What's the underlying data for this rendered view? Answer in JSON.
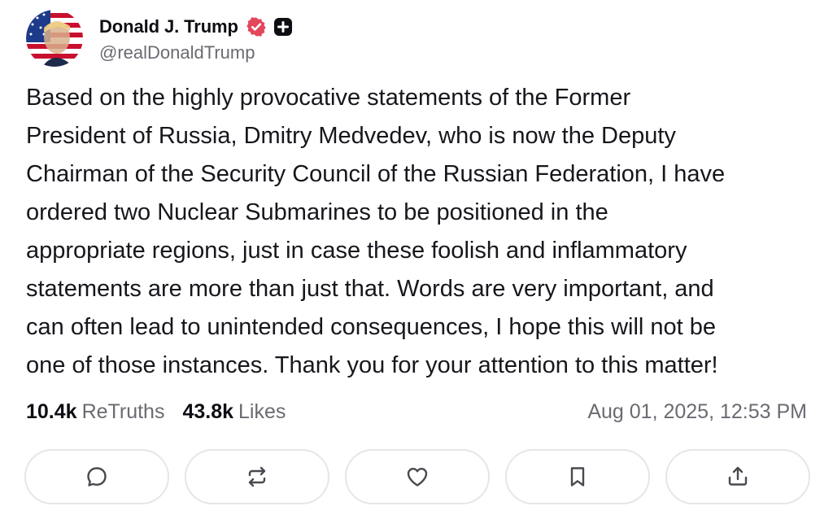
{
  "author": {
    "display_name": "Donald J. Trump",
    "handle": "@realDonaldTrump",
    "avatar_icon": "flag-portrait-avatar",
    "verified_icon": "verified-badge-icon",
    "plus_icon": "plus-badge-icon"
  },
  "post": {
    "lines": [
      "Based on the highly provocative statements of the Former",
      "President of Russia, Dmitry Medvedev, who is now the Deputy",
      "Chairman of the Security Council of the Russian Federation, I have",
      "ordered two Nuclear Submarines to be positioned in the",
      "appropriate regions, just in case these foolish and inflammatory",
      "statements are more than just that. Words are very important, and",
      "can often lead to unintended consequences, I hope this will not be",
      "one of those instances. Thank you for your attention to this matter!"
    ]
  },
  "stats": {
    "retruths_count": "10.4k",
    "retruths_label": "ReTruths",
    "likes_count": "43.8k",
    "likes_label": "Likes",
    "timestamp": "Aug 01, 2025, 12:53 PM"
  },
  "actions": [
    {
      "icon": "reply-icon"
    },
    {
      "icon": "retruth-icon"
    },
    {
      "icon": "like-icon"
    },
    {
      "icon": "bookmark-icon"
    },
    {
      "icon": "share-icon"
    }
  ],
  "colors": {
    "verified_badge": "#e3475c",
    "secondary_text": "#6b6a72",
    "button_border": "#e6e5ea",
    "icon_stroke": "#4a4950"
  }
}
